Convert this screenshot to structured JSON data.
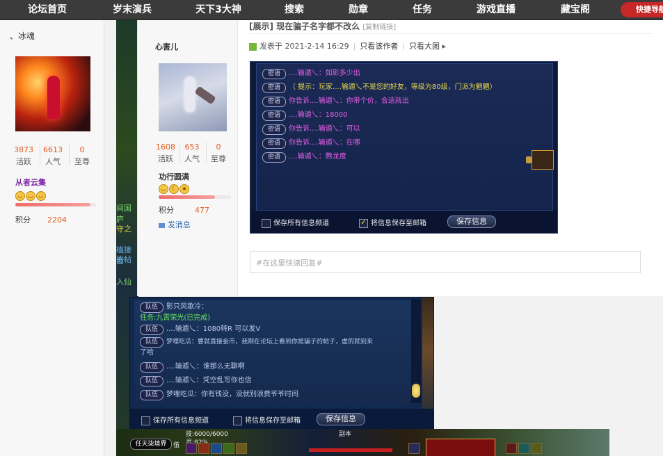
{
  "nav": {
    "items": [
      "论坛首页",
      "岁末演兵",
      "天下3大神",
      "搜索",
      "勋章",
      "任务",
      "游戏直播",
      "藏宝阁"
    ],
    "quick": "快捷导航"
  },
  "left_user": {
    "name": "、冰魂",
    "stats": [
      {
        "value": "3873",
        "label": "活跃"
      },
      {
        "value": "6613",
        "label": "人气"
      },
      {
        "value": "0",
        "label": "至尊"
      }
    ],
    "rank": "从者云集",
    "level_fraction": 0.93,
    "score_label": "积分",
    "score_value": "2204"
  },
  "bg_strip": {
    "lines": [
      "间国庐",
      "守之",
      "植接金",
      "的帖",
      "入仙"
    ]
  },
  "post": {
    "title": "[展示] 现在骗子名字都不改么",
    "copy_link": "[复制链接]",
    "posted": "发表于 2021-2-14 16:29",
    "only_author": "只看该作者",
    "big_image": "只看大图",
    "author": {
      "name": "心害儿",
      "stats": [
        {
          "value": "1608",
          "label": "活跃"
        },
        {
          "value": "653",
          "label": "人气"
        },
        {
          "value": "0",
          "label": "至尊"
        }
      ],
      "rank": "功行圆满",
      "level_fraction": 0.78,
      "score_label": "积分",
      "score_value": "477",
      "message": "发消息"
    },
    "reply_placeholder": "#在这里快速回复#"
  },
  "shot1": {
    "tag": "密语",
    "lines": [
      {
        "tag": "密语",
        "text": "....输遁乀：如影多少出"
      },
      {
        "tag": "密语",
        "text": "（ 提示：玩家....输遁乀不是您的好友，等级为80级，门派为魍魉）"
      },
      {
        "tag": "密语",
        "text": "你告诉....输遁乀：你带个价，合适就出"
      },
      {
        "tag": "密语",
        "text": "....输遁乀：18000"
      },
      {
        "tag": "密语",
        "text": "你告诉....输遁乀：可以"
      },
      {
        "tag": "密语",
        "text": "你告诉....输遁乀：在哪"
      },
      {
        "tag": "密语",
        "text": "....输遁乀：腾龙度"
      }
    ],
    "opt_all": "保存所有信息频道",
    "opt_mail": "将信息保存至邮箱",
    "save": "保存信息"
  },
  "shot2": {
    "lines": [
      {
        "tag": "队伍",
        "text": "影只风歌冷："
      },
      {
        "tag": "",
        "text": "任务:九霄荣光(已完成)"
      },
      {
        "tag": "队伍",
        "text": "....输遁乀：1080转R  可以发V"
      },
      {
        "tag": "队伍",
        "text": "梦哩吃瓜：要就直接金币，我刚在论坛上看到你是骗子的帖子，虚的就别来"
      },
      {
        "tag": "",
        "text": "了哈"
      },
      {
        "tag": "队伍",
        "text": "....输遁乀：谁那么无聊啊"
      },
      {
        "tag": "队伍",
        "text": "....输遁乀：凭空乱写你也信"
      },
      {
        "tag": "队伍",
        "text": "梦哩吃瓜：你有钱没，没就别浪费爷爷时间"
      }
    ],
    "opt_all": "保存所有信息频道",
    "opt_mail": "将信息保存至邮箱",
    "save": "保存信息"
  },
  "gamebar": {
    "world": "任天柒境界",
    "mid": "伍",
    "stat1": "技:6000/6000",
    "stat2": "灵:82%",
    "zone": "副本"
  }
}
